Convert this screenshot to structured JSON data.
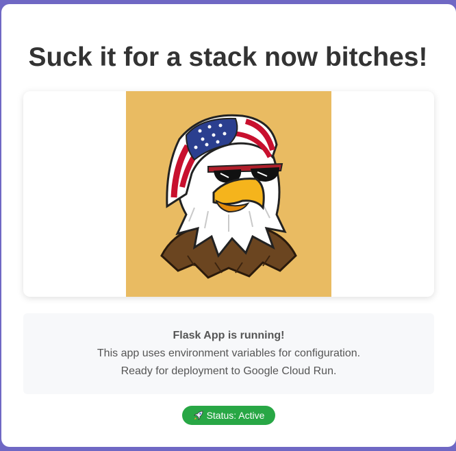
{
  "page": {
    "title": "Suck it for a stack now bitches!"
  },
  "hero_image": {
    "description_icon": "patriotic-eagle-image"
  },
  "info": {
    "heading": "Flask App is running!",
    "line1": "This app uses environment variables for configuration.",
    "line2": "Ready for deployment to Google Cloud Run."
  },
  "status": {
    "icon": "rocket-icon",
    "label": "Status: Active"
  },
  "colors": {
    "frame": "#6f68c4",
    "status_green": "#28a745",
    "image_bg": "#e9bb62"
  }
}
